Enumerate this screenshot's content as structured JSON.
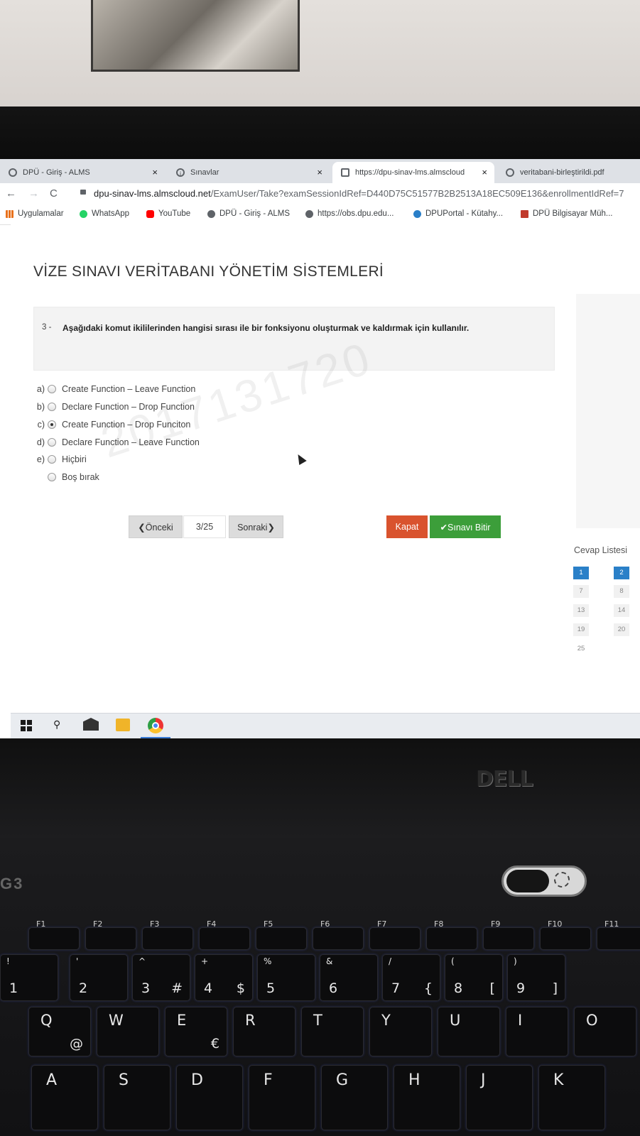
{
  "browser": {
    "tabs": [
      {
        "label": "DPÜ - Giriş - ALMS",
        "active": false
      },
      {
        "label": "Sınavlar",
        "active": false
      },
      {
        "label": "https://dpu-sinav-lms.almscloud",
        "active": true
      },
      {
        "label": "veritabani-birleştirildi.pdf",
        "active": false
      }
    ],
    "url_host": "dpu-sinav-lms.almscloud.net",
    "url_path": "/ExamUser/Take?examSessionIdRef=D440D75C51577B2B2513A18EC509E136&enrollmentIdRef=7",
    "bookmarks": [
      "Uygulamalar",
      "WhatsApp",
      "YouTube",
      "DPÜ - Giriş - ALMS",
      "https://obs.dpu.edu...",
      "DPUPortal - Kütahy...",
      "DPÜ Bilgisayar Müh..."
    ]
  },
  "exam": {
    "title": "VİZE SINAVI VERİTABANI YÖNETİM SİSTEMLERİ",
    "question_number": "3 -",
    "question_text": "Aşağıdaki komut ikililerinden hangisi sırası ile bir fonksiyonu oluşturmak ve kaldırmak için kullanılır.",
    "options": [
      {
        "letter": "a)",
        "text": "Create Function – Leave Function",
        "selected": false
      },
      {
        "letter": "b)",
        "text": "Declare Function – Drop Function",
        "selected": false
      },
      {
        "letter": "c)",
        "text": "Create Function – Drop Funciton",
        "selected": true
      },
      {
        "letter": "d)",
        "text": "Declare Function – Leave Function",
        "selected": false
      },
      {
        "letter": "e)",
        "text": "Hiçbiri",
        "selected": false
      },
      {
        "letter": "",
        "text": "Boş bırak",
        "selected": false
      }
    ],
    "watermark": "2017131720",
    "prev_label": "❮Önceki",
    "page_indicator": "3/25",
    "next_label": "Sonraki❯",
    "close_label": "Kapat",
    "finish_label": "✔Sınavı Bitir",
    "answer_list_title": "Cevap Listesi",
    "answer_list": [
      "1",
      "2",
      "7",
      "8",
      "13",
      "14",
      "19",
      "20",
      "25"
    ],
    "current_question": "1"
  },
  "laptop": {
    "brand": "DELL",
    "badge": "G3",
    "fkeys": [
      "F1",
      "F2",
      "F3",
      "F4",
      "F5",
      "F6",
      "F7",
      "F8",
      "F9",
      "F10",
      "F11"
    ],
    "number_row": [
      {
        "top": "!",
        "bot": "1",
        "alt": ""
      },
      {
        "top": "'",
        "bot": "2",
        "alt": ""
      },
      {
        "top": "^",
        "bot": "3",
        "alt": "#"
      },
      {
        "top": "+",
        "bot": "4",
        "alt": "$"
      },
      {
        "top": "%",
        "bot": "5",
        "alt": ""
      },
      {
        "top": "&",
        "bot": "6",
        "alt": ""
      },
      {
        "top": "/",
        "bot": "7",
        "alt": "{"
      },
      {
        "top": "(",
        "bot": "8",
        "alt": "["
      },
      {
        "top": ")",
        "bot": "9",
        "alt": "]"
      }
    ],
    "q_row": [
      {
        "bot": "Q",
        "alt": "@"
      },
      {
        "bot": "W",
        "alt": ""
      },
      {
        "bot": "E",
        "alt": "€"
      },
      {
        "bot": "R",
        "alt": ""
      },
      {
        "bot": "T",
        "alt": ""
      },
      {
        "bot": "Y",
        "alt": ""
      },
      {
        "bot": "U",
        "alt": ""
      },
      {
        "bot": "I",
        "alt": ""
      },
      {
        "bot": "O",
        "alt": ""
      }
    ],
    "a_row": [
      "A",
      "S",
      "D",
      "F",
      "G",
      "H",
      "J",
      "K"
    ]
  }
}
